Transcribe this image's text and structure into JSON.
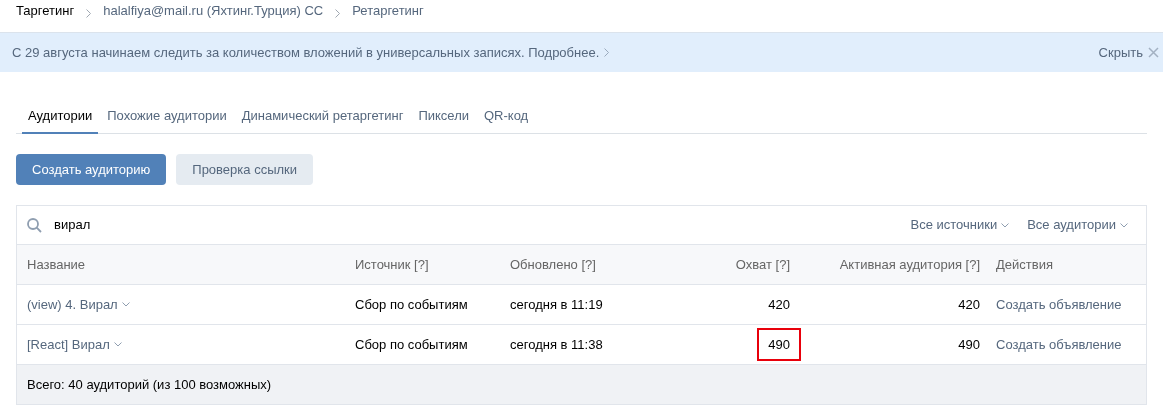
{
  "breadcrumbs": [
    "Таргетинг",
    "halalfiya@mail.ru (Яхтинг.Турция) СС",
    "Ретаргетинг"
  ],
  "banner": {
    "text": "С 29 августа начинаем следить за количеством вложений в универсальных записях. Подробнее.",
    "hide": "Скрыть"
  },
  "tabs": [
    {
      "label": "Аудитории",
      "selected": true
    },
    {
      "label": "Похожие аудитории",
      "selected": false
    },
    {
      "label": "Динамический ретаргетинг",
      "selected": false
    },
    {
      "label": "Пиксели",
      "selected": false
    },
    {
      "label": "QR-код",
      "selected": false
    }
  ],
  "buttons": [
    {
      "label": "Создать аудиторию",
      "kind": "primary"
    },
    {
      "label": "Проверка ссылки",
      "kind": "secondary"
    }
  ],
  "search": {
    "value": "вирал"
  },
  "filters": [
    "Все источники",
    "Все аудитории"
  ],
  "table": {
    "columns": [
      "Название",
      "Источник [?]",
      "Обновлено [?]",
      "Охват [?]",
      "Активная аудитория [?]",
      "Действия"
    ],
    "rows": [
      {
        "name": "(view) 4. Вирал",
        "source": "Сбор по событиям",
        "updated": "сегодня в 11:19",
        "reach": "420",
        "reach_highlighted": false,
        "active": "420",
        "action": "Создать объявление"
      },
      {
        "name": "[React] Вирал",
        "source": "Сбор по событиям",
        "updated": "сегодня в 11:38",
        "reach": "490",
        "reach_highlighted": true,
        "active": "490",
        "action": "Создать объявление"
      }
    ],
    "footer": "Всего: 40 аудиторий (из 100 возможных)"
  }
}
